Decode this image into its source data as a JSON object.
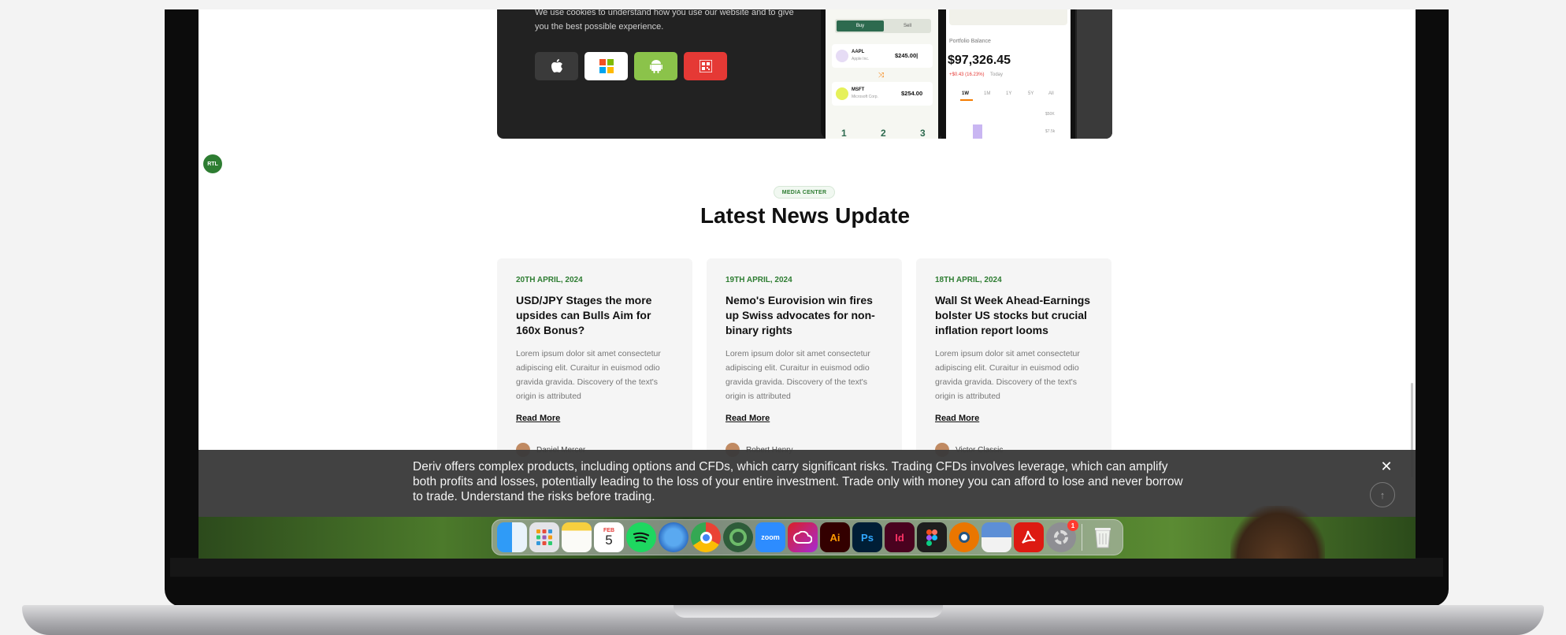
{
  "promo": {
    "cookie_text": "We use cookies to understand how you use our website and to give you the best possible experience.",
    "store_buttons": [
      {
        "name": "apple",
        "color": "#3a3a3a"
      },
      {
        "name": "windows",
        "color": "#ffffff"
      },
      {
        "name": "android",
        "color": "#8bc34a"
      },
      {
        "name": "qr-code",
        "color": "#e53935"
      }
    ],
    "phone1": {
      "buy": "Buy",
      "sell": "Sell",
      "stocks": [
        {
          "ticker": "AAPL",
          "company": "Apple Inc.",
          "price": "$245.00|"
        },
        {
          "ticker": "MSFT",
          "company": "Microsoft Corp.",
          "price": "$254.00"
        }
      ],
      "pages": [
        "1",
        "2",
        "3"
      ]
    },
    "phone2": {
      "balance_label": "Portfolio Balance",
      "balance_value": "$97,326.45",
      "change": "+$0.43 (16.23%)",
      "change_period": "Today",
      "ranges": [
        "1W",
        "1M",
        "1Y",
        "5Y",
        "All"
      ],
      "axis_1": "$50K",
      "axis_2": "$7.5k"
    }
  },
  "rtl_badge": "RTL",
  "section": {
    "pill": "MEDIA CENTER",
    "title": "Latest News Update"
  },
  "news": [
    {
      "date": "20TH APRIL, 2024",
      "title": "USD/JPY Stages the more upsides can Bulls Aim for 160x Bonus?",
      "excerpt": "Lorem ipsum dolor sit amet consectetur adipiscing elit. Curaitur in euismod odio gravida gravida. Discovery of the text's origin is attributed",
      "read_more": "Read More",
      "author": "Daniel Mercer"
    },
    {
      "date": "19TH APRIL, 2024",
      "title": "Nemo's Eurovision win fires up Swiss advocates for non-binary rights",
      "excerpt": "Lorem ipsum dolor sit amet consectetur adipiscing elit. Curaitur in euismod odio gravida gravida. Discovery of the text's origin is attributed",
      "read_more": "Read More",
      "author": "Robert Henry"
    },
    {
      "date": "18TH APRIL, 2024",
      "title": "Wall St Week Ahead-Earnings bolster US stocks but crucial inflation report looms",
      "excerpt": "Lorem ipsum dolor sit amet consectetur adipiscing elit. Curaitur in euismod odio gravida gravida. Discovery of the text's origin is attributed",
      "read_more": "Read More",
      "author": "Victor Classic"
    }
  ],
  "risk_banner": {
    "text": "Deriv offers complex products, including options and CFDs, which carry significant risks. Trading CFDs involves leverage, which can amplify both profits and losses, potentially leading to the loss of your entire investment. Trade only with money you can afford to lose and never borrow to trade. Understand the risks before trading.",
    "close_icon": "close-icon",
    "scroll_top_icon": "arrow-up-icon"
  },
  "dock": {
    "calendar_month": "FEB",
    "calendar_day": "5",
    "zoom_label": "zoom",
    "ai_label": "Ai",
    "ps_label": "Ps",
    "id_label": "Id",
    "settings_badge": "1",
    "apps": [
      "Finder",
      "Launchpad",
      "Notes",
      "Calendar",
      "Spotify",
      "Cloud",
      "Chrome",
      "Circle",
      "Zoom",
      "Creative Cloud",
      "Illustrator",
      "Photoshop",
      "InDesign",
      "Figma",
      "Blender",
      "Preview",
      "Acrobat",
      "System Settings",
      "Trash"
    ]
  }
}
